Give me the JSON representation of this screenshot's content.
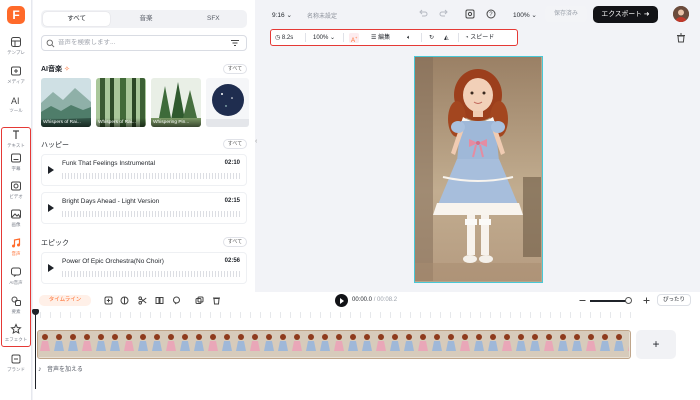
{
  "app": {
    "logo_letter": "F"
  },
  "rail": {
    "items": [
      {
        "label": "テンプレ",
        "icon": "template-icon"
      },
      {
        "label": "メディア",
        "icon": "media-icon"
      },
      {
        "label": "ツール",
        "icon": "ai-tools-icon"
      },
      {
        "label": "テキスト",
        "icon": "text-icon"
      },
      {
        "label": "字幕",
        "icon": "subtitle-icon"
      },
      {
        "label": "ビデオ",
        "icon": "video-icon"
      },
      {
        "label": "画像",
        "icon": "image-icon"
      },
      {
        "label": "音声",
        "icon": "music-icon"
      },
      {
        "label": "AI音声",
        "icon": "ai-voice-icon"
      },
      {
        "label": "要素",
        "icon": "elements-icon"
      },
      {
        "label": "エフェクト",
        "icon": "effects-icon"
      },
      {
        "label": "ブランド",
        "icon": "brand-icon"
      }
    ],
    "active_index": 7
  },
  "panel": {
    "tabs": [
      "すべて",
      "音楽",
      "SFX"
    ],
    "active_tab": 0,
    "search_placeholder": "音声を検索します...",
    "ai_section": {
      "title": "AI音楽",
      "all_label": "すべて"
    },
    "ai_thumbs": [
      "Whispers of Rai...",
      "Whispers of Rai...",
      "Whispering Pin...",
      ""
    ],
    "happy_section": {
      "title": "ハッピー",
      "all_label": "すべて"
    },
    "epic_section": {
      "title": "エピック",
      "all_label": "すべて"
    },
    "tracks": [
      {
        "name": "Funk That Feelings Instrumental",
        "duration": "02:10"
      },
      {
        "name": "Bright Days Ahead - Light Version",
        "duration": "02:15"
      },
      {
        "name": "Power Of Epic Orchestra(No Choir)",
        "duration": "02:56"
      }
    ]
  },
  "topbar": {
    "ratio": "9:16",
    "project_name": "名称未設定",
    "zoom": "100%",
    "save_label": "保存済み",
    "export_label": "エクスポート"
  },
  "toolbar": {
    "duration": "8.2s",
    "scale": "100%",
    "edit_label": "編集",
    "speed_label": "スピード"
  },
  "timeline": {
    "pill_label": "タイムライン",
    "current_time": "00:00.0",
    "total_time": "00:08.2",
    "fit_label": "ぴったり",
    "add_audio_label": "音声を加える"
  },
  "colors": {
    "accent": "#ff6a2a",
    "highlight_red": "#e53935",
    "canvas_border": "#49c8d6",
    "export_bg": "#121317"
  }
}
